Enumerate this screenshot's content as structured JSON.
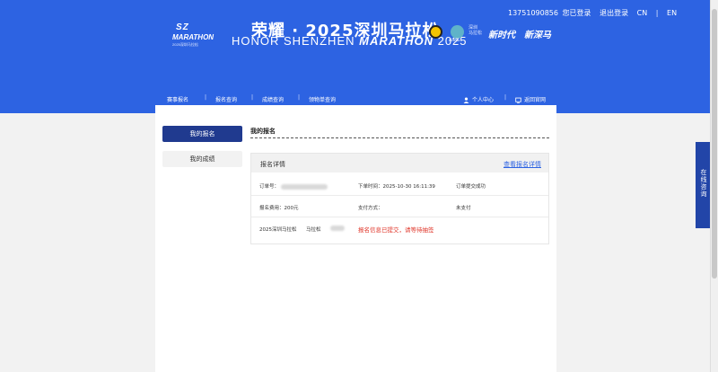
{
  "header": {
    "logo_line1": "SZ",
    "logo_line2": "MARATHON",
    "logo_line3": "2025深圳马拉松",
    "title_cn": "荣耀 · 2025深圳马拉松",
    "title_en_a": "HONOR SHENZHEN ",
    "title_en_b": "MARATHON",
    "title_en_c": " 2025",
    "badge_aims": "AIMS",
    "badge_extra": "深圳 马拉松",
    "calligraphy_1": "新时代",
    "calligraphy_2": "新深马"
  },
  "topbar": {
    "phone": "13751090856",
    "logged_in": "您已登录",
    "logout": "退出登录",
    "lang_cn": "CN",
    "sep": "|",
    "lang_en": "EN"
  },
  "nav": {
    "items": [
      "赛事报名",
      "报名查询",
      "成绩查询",
      "领物单查询"
    ],
    "sep": "|",
    "user_center": "个人中心",
    "back_official": "返回官网"
  },
  "sidebar": {
    "my_registration": "我的报名",
    "my_results": "我的成绩"
  },
  "main": {
    "section_title": "我的报名",
    "panel_title": "报名详情",
    "view_details": "查看报名详情",
    "order_no_label": "订单号：",
    "order_time_label": "下单时间：",
    "order_time_value": "2025-10-30 16:11:39",
    "order_status": "订单提交成功",
    "fee_label": "报名费用：",
    "fee_value": "200元",
    "payment_label": "支付方式：",
    "payment_status": "未支付",
    "event_name": "2025深圳马拉松",
    "event_type": "马拉松",
    "submit_msg": "报名信息已提交，请等待抽签"
  },
  "float": {
    "consult": "在线咨询"
  },
  "colors": {
    "header_blue": "#2d63e2",
    "dark_navy": "#203a8f",
    "float_blue": "#2245a8",
    "link_blue": "#2d63e2",
    "error_red": "#e0372b"
  }
}
